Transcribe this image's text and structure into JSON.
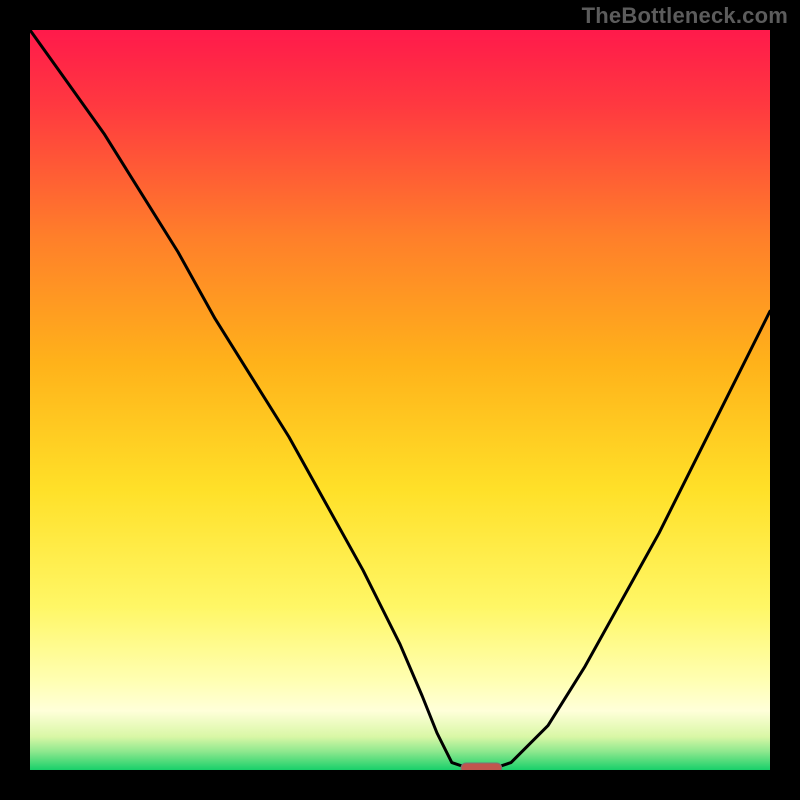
{
  "watermark": "TheBottleneck.com",
  "colors": {
    "frame": "#000000",
    "curve": "#000000",
    "marker_fill": "#c1554e",
    "marker_stroke": "#777777",
    "gradient_stops": [
      {
        "offset": 0.0,
        "color": "#ff1a4b"
      },
      {
        "offset": 0.1,
        "color": "#ff3840"
      },
      {
        "offset": 0.28,
        "color": "#ff7f2a"
      },
      {
        "offset": 0.45,
        "color": "#ffb21a"
      },
      {
        "offset": 0.62,
        "color": "#ffe028"
      },
      {
        "offset": 0.78,
        "color": "#fff766"
      },
      {
        "offset": 0.88,
        "color": "#ffffb3"
      },
      {
        "offset": 0.92,
        "color": "#ffffd9"
      },
      {
        "offset": 0.955,
        "color": "#d9f7a6"
      },
      {
        "offset": 0.975,
        "color": "#8ee88e"
      },
      {
        "offset": 1.0,
        "color": "#18d06a"
      }
    ]
  },
  "chart_data": {
    "type": "line",
    "title": "",
    "xlabel": "",
    "ylabel": "",
    "xlim": [
      0,
      100
    ],
    "ylim": [
      0,
      100
    ],
    "grid": false,
    "legend": false,
    "series": [
      {
        "name": "bottleneck-curve",
        "x": [
          0,
          5,
          10,
          15,
          20,
          25,
          30,
          35,
          40,
          45,
          50,
          53,
          55,
          57,
          60,
          62,
          65,
          70,
          75,
          80,
          85,
          90,
          95,
          100
        ],
        "y": [
          100,
          93,
          86,
          78,
          70,
          61,
          53,
          45,
          36,
          27,
          17,
          10,
          5,
          1,
          0,
          0,
          1,
          6,
          14,
          23,
          32,
          42,
          52,
          62
        ]
      }
    ],
    "marker": {
      "x_center": 61,
      "y": 0,
      "width": 5.5
    }
  }
}
